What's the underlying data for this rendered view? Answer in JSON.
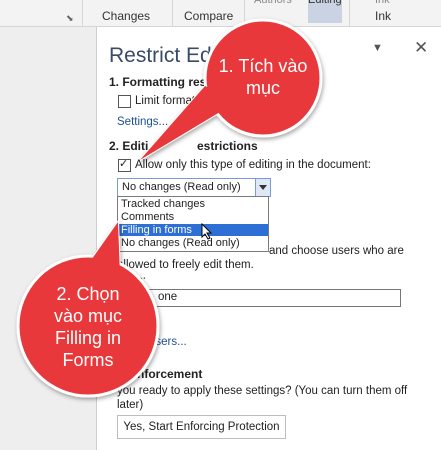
{
  "ribbon": {
    "groups": [
      {
        "label": "Changes"
      },
      {
        "label": "Compare"
      },
      {
        "label": "Authors"
      },
      {
        "label": "Editing"
      },
      {
        "label": "Ink"
      },
      {
        "label": "Ink"
      }
    ]
  },
  "pane": {
    "title": "Restrict Edi",
    "pin_glyph": "▼",
    "close_glyph": "✕",
    "formatting": {
      "heading": "1. Formatting res",
      "checkbox_label": "Limit formatti",
      "settings_link": "Settings..."
    },
    "editing": {
      "heading": "2. Editi",
      "heading_tail": "estrictions",
      "checkbox_label": "Allow only this type of editing in the document:",
      "selected": "No changes (Read only)",
      "options": [
        "Tracked changes",
        "Comments",
        "Filling in forms",
        "No changes (Read only)"
      ],
      "highlighted_index": 2
    },
    "exceptions": {
      "line1_tail": "and choose users who are",
      "line2": "allowed to freely edit them.",
      "groups_label": "s:",
      "everyone": "one",
      "more_users_link": "users..."
    },
    "enforcement": {
      "heading": "nforcement",
      "question": "you ready to apply these settings? (You can turn them off",
      "question_line2": "later)",
      "button": "Yes, Start Enforcing Protection"
    }
  },
  "callouts": {
    "first": {
      "line1": "1. Tích vào",
      "line2": "mục"
    },
    "second": {
      "line1": "2. Chọn",
      "line2": "vào mục",
      "line3": "Filling in",
      "line4": "Forms"
    }
  },
  "colors": {
    "callout": "#e8393b",
    "accent": "#2d6fd4",
    "title": "#3a4b66"
  }
}
